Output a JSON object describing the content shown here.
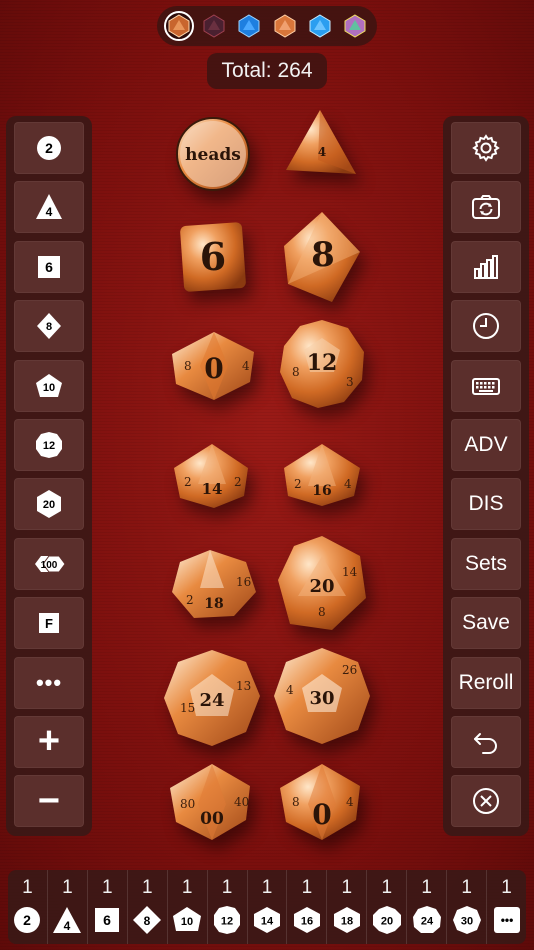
{
  "skins": [
    {
      "name": "copper-skin",
      "color": "#c8652e",
      "selected": true
    },
    {
      "name": "dark-red-skin",
      "color": "#5a2a3a",
      "selected": false
    },
    {
      "name": "blue-skin",
      "color": "#2a8ff0",
      "selected": false
    },
    {
      "name": "orange-skin",
      "color": "#d87a3a",
      "selected": false
    },
    {
      "name": "sky-skin",
      "color": "#2fa8f0",
      "selected": false
    },
    {
      "name": "rainbow-skin",
      "color": "#b070c0",
      "selected": false
    }
  ],
  "total": "Total: 264",
  "left_panel": {
    "d2": "2",
    "d4": "4",
    "d6": "6",
    "d8": "8",
    "d10": "10",
    "d12": "12",
    "d20": "20",
    "d100": "100",
    "fudge": "F",
    "more": "•••",
    "plus": "+",
    "minus": "−"
  },
  "right_panel": {
    "adv": "ADV",
    "dis": "DIS",
    "sets": "Sets",
    "save": "Save",
    "reroll": "Reroll"
  },
  "dice": {
    "d2": "heads",
    "d4": "4",
    "d6": "6",
    "d8": "8",
    "d10": "0",
    "d12": "12",
    "d14": "14",
    "d16": "16",
    "d18": "18",
    "d20": "20",
    "d24": "24",
    "d30": "30",
    "d100_tens": "00",
    "d100_ones": "0"
  },
  "bottom_bar": [
    {
      "count": "1",
      "label": "2"
    },
    {
      "count": "1",
      "label": "4"
    },
    {
      "count": "1",
      "label": "6"
    },
    {
      "count": "1",
      "label": "8"
    },
    {
      "count": "1",
      "label": "10"
    },
    {
      "count": "1",
      "label": "12"
    },
    {
      "count": "1",
      "label": "14"
    },
    {
      "count": "1",
      "label": "16"
    },
    {
      "count": "1",
      "label": "18"
    },
    {
      "count": "1",
      "label": "20"
    },
    {
      "count": "1",
      "label": "24"
    },
    {
      "count": "1",
      "label": "30"
    },
    {
      "count": "1",
      "label": "•••"
    }
  ],
  "colors": {
    "background": "#7d1010",
    "panel": "#3a1816",
    "button": "#5b2f2c",
    "die_copper": "#d9803a"
  }
}
